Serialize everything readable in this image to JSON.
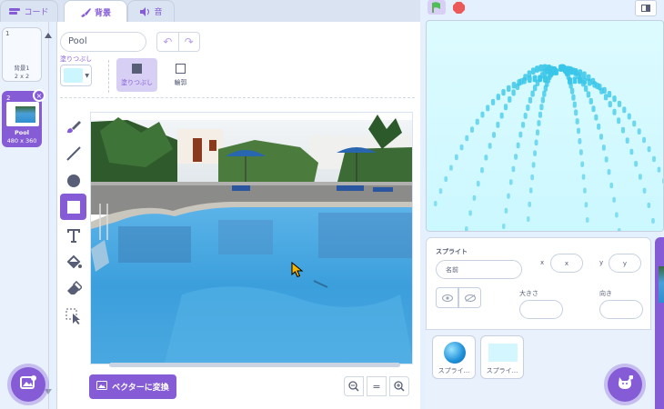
{
  "tabs": [
    {
      "label": "コード",
      "icon": "code-blocks-icon"
    },
    {
      "label": "背景",
      "icon": "paintbrush-icon"
    },
    {
      "label": "音",
      "icon": "speaker-icon"
    }
  ],
  "backdrops": [
    {
      "number": "1",
      "name": "背景1",
      "size": "2 x 2"
    },
    {
      "number": "2",
      "name": "Pool",
      "size": "480 x 360"
    }
  ],
  "editor": {
    "costume_name": "Pool",
    "fill_label": "塗りつぶし",
    "fill_color": "#ccf6ff",
    "mode_fill_label": "塗りつぶし",
    "mode_outline_label": "輪郭",
    "convert_label": "ベクターに変換",
    "zoom_out": "−",
    "zoom_reset": "=",
    "zoom_in": "+"
  },
  "tools": [
    "brush-icon",
    "line-icon",
    "circle-icon",
    "rectangle-icon",
    "text-icon",
    "fill-icon",
    "eraser-icon",
    "select-icon"
  ],
  "sprite_panel": {
    "title": "スプライト",
    "name_placeholder": "名前",
    "x_label": "x",
    "x_value": "x",
    "y_label": "y",
    "y_value": "y",
    "size_label": "大きさ",
    "direction_label": "向き"
  },
  "sprites": [
    {
      "name": "スプライ..."
    },
    {
      "name": "スプライ..."
    }
  ],
  "colors": {
    "accent": "#855cd6",
    "stage_bg": "#ccf8ff",
    "water": "#39c6e8"
  }
}
